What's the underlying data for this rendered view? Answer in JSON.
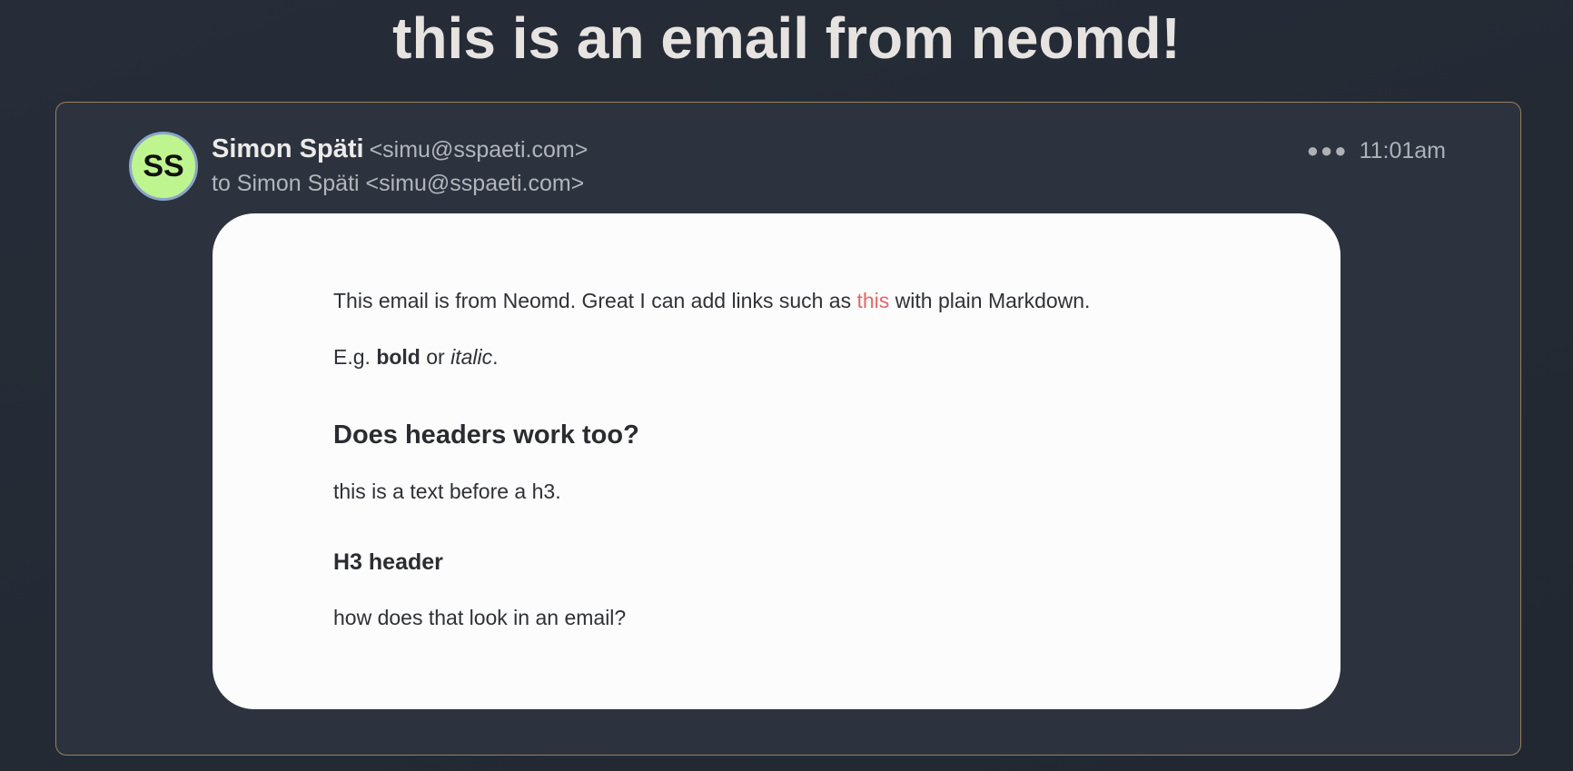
{
  "email": {
    "subject": "this is an email from neomd!",
    "avatar_initials": "SS",
    "avatar_color": "#bff58f",
    "sender_name": "Simon Späti",
    "sender_email": "<simu@sspaeti.com>",
    "recipient_line": "to Simon Späti <simu@sspaeti.com>",
    "more_icon": "more-horizontal-icon",
    "time": "11:01am"
  },
  "body": {
    "p1_before": "This email is from Neomd. Great I can add links such as ",
    "p1_link": "this",
    "p1_after": " with plain Markdown.",
    "p2_prefix": "E.g. ",
    "p2_bold": "bold",
    "p2_middle": " or ",
    "p2_italic": "italic",
    "p2_suffix": ".",
    "h2": "Does headers work too?",
    "p3": "this is a text before a h3.",
    "h3": "H3 header",
    "p4": "how does that look in an email?"
  },
  "colors": {
    "page_background": "#242b35",
    "card_border": "#9a8057",
    "link": "#e3676a"
  }
}
